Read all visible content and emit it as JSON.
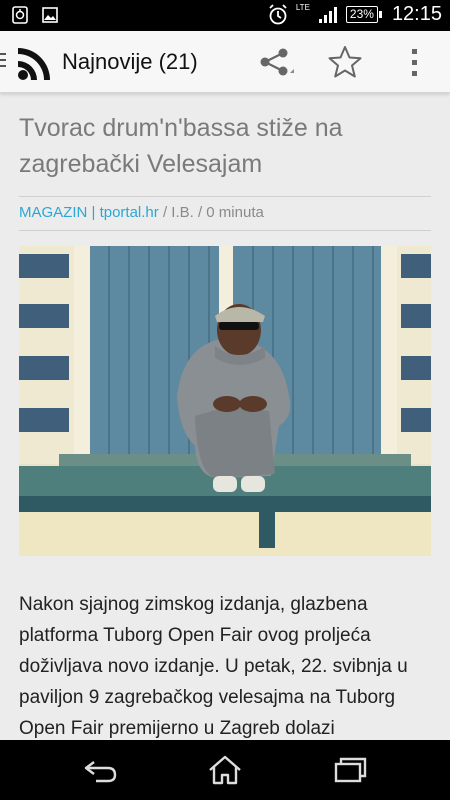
{
  "status_bar": {
    "network": "LTE",
    "battery": "23%",
    "time": "12:15",
    "icons": [
      "sync-icon",
      "image-icon",
      "alarm-icon",
      "signal-icon"
    ]
  },
  "action_bar": {
    "title": "Najnovije (21)",
    "icons": [
      "rss-logo-icon",
      "share-icon",
      "star-icon",
      "overflow-menu-icon"
    ]
  },
  "article": {
    "title": "Tvorac drum'n'bassa stiže na zagrebački Velesajam",
    "category": "MAGAZIN",
    "separator": " | ",
    "source": "tportal.hr",
    "byline": " / I.B. / 0 minuta",
    "body": "Nakon sjajnog zimskog izdanja, glazbena platforma Tuborg Open Fair ovog proljeća doživljava novo izdanje. U petak, 22. svibnja u paviljon 9 zagrebačkog velesajma na Tuborg Open Fair premijerno u Zagreb dolazi"
  },
  "nav_bar": {
    "icons": [
      "back-icon",
      "home-icon",
      "recent-apps-icon"
    ]
  },
  "colors": {
    "accent": "#2aa7d6",
    "title_gray": "#7a7a7a"
  }
}
